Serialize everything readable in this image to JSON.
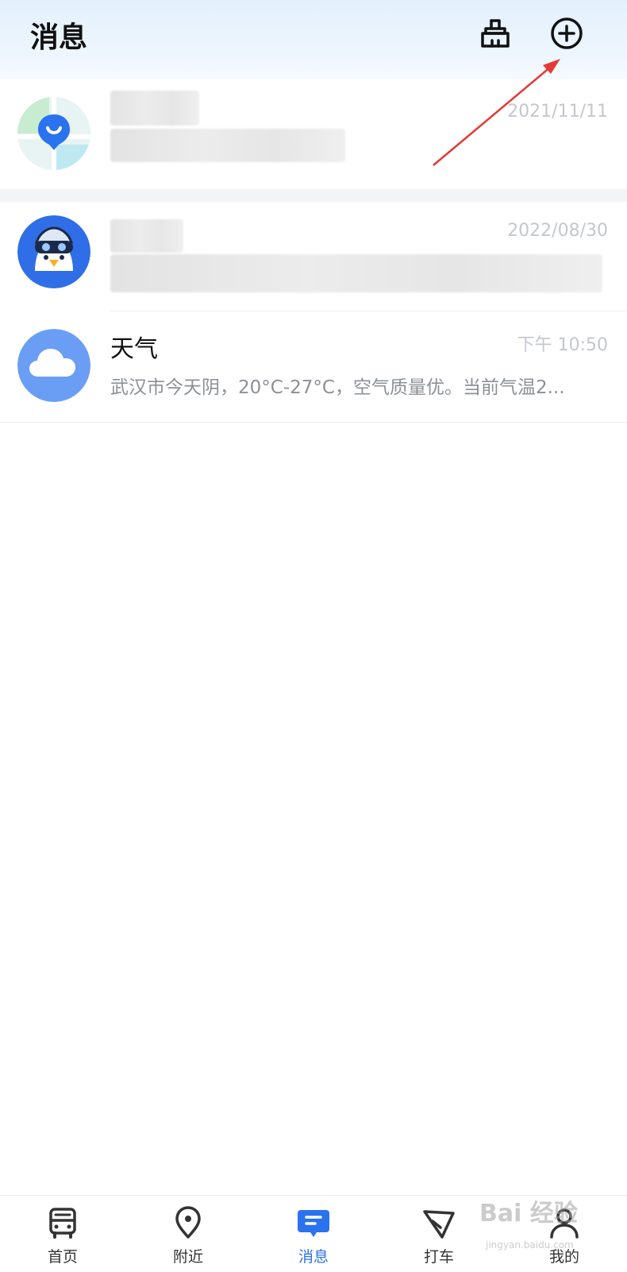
{
  "header": {
    "title": "消息",
    "clear_icon": "broom-icon",
    "add_icon": "plus-circle-icon"
  },
  "messages": [
    {
      "name": "",
      "time": "2021/11/11",
      "preview": "",
      "avatar_icon": "map-pin-logo-icon",
      "blurred": true
    },
    {
      "name": "",
      "time": "2022/08/30",
      "preview": "",
      "avatar_icon": "penguin-mascot-icon",
      "blurred": true
    },
    {
      "name": "天气",
      "time": "下午 10:50",
      "preview": "武汉市今天阴，20°C-27°C，空气质量优。当前气温2...",
      "avatar_icon": "cloud-icon",
      "blurred": false
    }
  ],
  "tabbar": {
    "items": [
      {
        "label": "首页",
        "icon": "bus-icon"
      },
      {
        "label": "附近",
        "icon": "location-pin-icon"
      },
      {
        "label": "消息",
        "icon": "message-icon",
        "active": true
      },
      {
        "label": "打车",
        "icon": "taxi-arrow-icon"
      },
      {
        "label": "我的",
        "icon": "user-icon"
      }
    ]
  },
  "watermark": {
    "text": "Bai 经验",
    "sub": "jingyan.baidu.com"
  },
  "colors": {
    "accent": "#2a72ee",
    "annotation_arrow": "#e53935"
  }
}
